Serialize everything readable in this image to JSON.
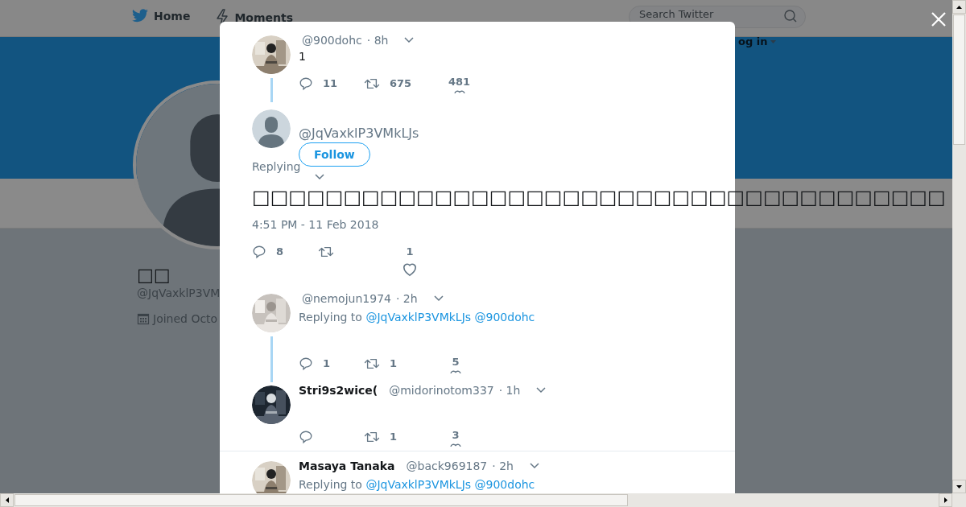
{
  "nav": {
    "items": [
      {
        "kind": "bird",
        "label": "Home"
      },
      {
        "kind": "bolt",
        "label": "Moments"
      }
    ],
    "search": {
      "placeholder": "Search Twitter"
    },
    "login": "og in"
  },
  "profile": {
    "name": "□□",
    "handle": "@JqVaxklP3VM",
    "joined": "Joined Octo"
  },
  "tweets": [
    {
      "kind": "reply",
      "handle": "@900dohc",
      "time": "· 8h",
      "text": "1",
      "thread": true,
      "actions": {
        "replies": "11",
        "retweets": "675",
        "likes": "481"
      }
    },
    {
      "kind": "focus",
      "handle": "@JqVaxklP3VMkLJs",
      "follow": "Follow",
      "replying": "Replying",
      "text": "□□□□□□□□□□□□□□□□□□□□□□□□□□□□□□□□□□□□□□",
      "timestamp": "4:51 PM - 11 Feb 2018",
      "actions": {
        "replies": "8",
        "likes": "1"
      }
    },
    {
      "kind": "reply",
      "handle": "@nemojun1974",
      "time": "· 2h",
      "replying_to": {
        "label": "Replying to",
        "mentions": [
          "@JqVaxklP3VMkLJs",
          "@900dohc"
        ]
      },
      "thread": true,
      "actions": {
        "replies": "1",
        "retweets": "1",
        "likes": "5"
      }
    },
    {
      "kind": "reply",
      "name": "Stri9s2wice(",
      "handle": "@midorinotom337",
      "time": "· 1h",
      "thread": false,
      "actions": {
        "retweets": "1",
        "likes": "3"
      }
    },
    {
      "kind": "reply",
      "name": "Masaya Tanaka",
      "handle": "@back969187",
      "time": "· 2h",
      "replying_to": {
        "label": "Replying to",
        "mentions": [
          "@JqVaxklP3VMkLJs",
          "@900dohc"
        ]
      },
      "thread": false,
      "divider": true
    }
  ]
}
